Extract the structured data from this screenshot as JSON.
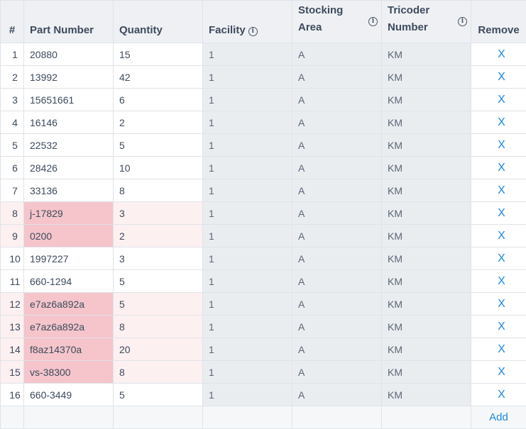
{
  "headers": {
    "row_number": "#",
    "part_number": "Part Number",
    "quantity": "Quantity",
    "facility": "Facility",
    "stocking_area_line1": "Stocking",
    "stocking_area_line2": "Area",
    "tricoder_line1": "Tricoder",
    "tricoder_line2": "Number",
    "remove": "Remove"
  },
  "info_glyph": "i",
  "remove_label": "X",
  "add_label": "Add",
  "colors": {
    "link": "#1e86e0",
    "invalid_cell": "#f5c5cb",
    "invalid_row": "#fdf0f1",
    "readonly_cell": "#eaedf0",
    "header_bg": "#eef0f3"
  },
  "rows": [
    {
      "n": "1",
      "part": "20880",
      "qty": "15",
      "facility": "1",
      "area": "A",
      "tricoder": "KM",
      "invalid": false
    },
    {
      "n": "2",
      "part": "13992",
      "qty": "42",
      "facility": "1",
      "area": "A",
      "tricoder": "KM",
      "invalid": false
    },
    {
      "n": "3",
      "part": "15651661",
      "qty": "6",
      "facility": "1",
      "area": "A",
      "tricoder": "KM",
      "invalid": false
    },
    {
      "n": "4",
      "part": "16146",
      "qty": "2",
      "facility": "1",
      "area": "A",
      "tricoder": "KM",
      "invalid": false
    },
    {
      "n": "5",
      "part": "22532",
      "qty": "5",
      "facility": "1",
      "area": "A",
      "tricoder": "KM",
      "invalid": false
    },
    {
      "n": "6",
      "part": "28426",
      "qty": "10",
      "facility": "1",
      "area": "A",
      "tricoder": "KM",
      "invalid": false
    },
    {
      "n": "7",
      "part": "33136",
      "qty": "8",
      "facility": "1",
      "area": "A",
      "tricoder": "KM",
      "invalid": false
    },
    {
      "n": "8",
      "part": "j-17829",
      "qty": "3",
      "facility": "1",
      "area": "A",
      "tricoder": "KM",
      "invalid": true
    },
    {
      "n": "9",
      "part": "0200",
      "qty": "2",
      "facility": "1",
      "area": "A",
      "tricoder": "KM",
      "invalid": true
    },
    {
      "n": "10",
      "part": "1997227",
      "qty": "3",
      "facility": "1",
      "area": "A",
      "tricoder": "KM",
      "invalid": false
    },
    {
      "n": "11",
      "part": "660-1294",
      "qty": "5",
      "facility": "1",
      "area": "A",
      "tricoder": "KM",
      "invalid": false
    },
    {
      "n": "12",
      "part": "e7az6a892a",
      "qty": "5",
      "facility": "1",
      "area": "A",
      "tricoder": "KM",
      "invalid": true
    },
    {
      "n": "13",
      "part": "e7az6a892a",
      "qty": "8",
      "facility": "1",
      "area": "A",
      "tricoder": "KM",
      "invalid": true
    },
    {
      "n": "14",
      "part": "f8az14370a",
      "qty": "20",
      "facility": "1",
      "area": "A",
      "tricoder": "KM",
      "invalid": true
    },
    {
      "n": "15",
      "part": "vs-38300",
      "qty": "8",
      "facility": "1",
      "area": "A",
      "tricoder": "KM",
      "invalid": true
    },
    {
      "n": "16",
      "part": "660-3449",
      "qty": "5",
      "facility": "1",
      "area": "A",
      "tricoder": "KM",
      "invalid": false
    }
  ]
}
